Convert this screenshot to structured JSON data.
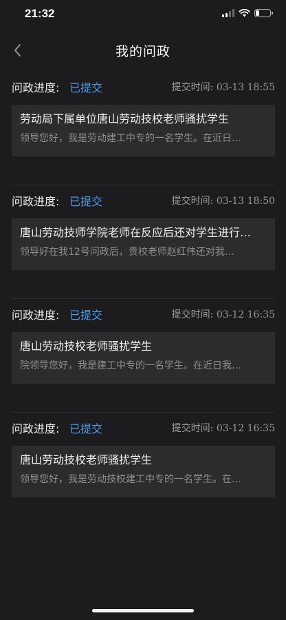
{
  "status_bar": {
    "time": "21:32",
    "icons": [
      "cellular-signal-icon",
      "wifi-icon",
      "battery-icon"
    ]
  },
  "nav": {
    "back_icon": "chevron-left-icon",
    "title": "我的问政"
  },
  "entries": [
    {
      "progress_label": "问政进度:",
      "progress_value": "已提交",
      "submit_time": "提交时间: 03-13 18:55",
      "title": "劳动局下属单位唐山劳动技校老师骚扰学生",
      "description": "领导您好，我是劳动建工中专的一名学生。在近日…"
    },
    {
      "progress_label": "问政进度:",
      "progress_value": "已提交",
      "submit_time": "提交时间: 03-13 18:50",
      "title": "唐山劳动技师学院老师在反应后还对学生进行…",
      "description": "领导好在我12号问政后，贵校老师赵红伟还对我…"
    },
    {
      "progress_label": "问政进度:",
      "progress_value": "已提交",
      "submit_time": "提交时间: 03-12 16:35",
      "title": "唐山劳动技校老师骚扰学生",
      "description": "院领导您好，我是建工中专的一名学生。在近日我…"
    },
    {
      "progress_label": "问政进度:",
      "progress_value": "已提交",
      "submit_time": "提交时间: 03-12 16:35",
      "title": "唐山劳动技校老师骚扰学生",
      "description": "领导您好，我是劳动技校建工中专的一名学生。在…"
    }
  ],
  "colors": {
    "background": "#1c1c1e",
    "card": "#2c2c2e",
    "status_accent": "#4f9bea"
  }
}
